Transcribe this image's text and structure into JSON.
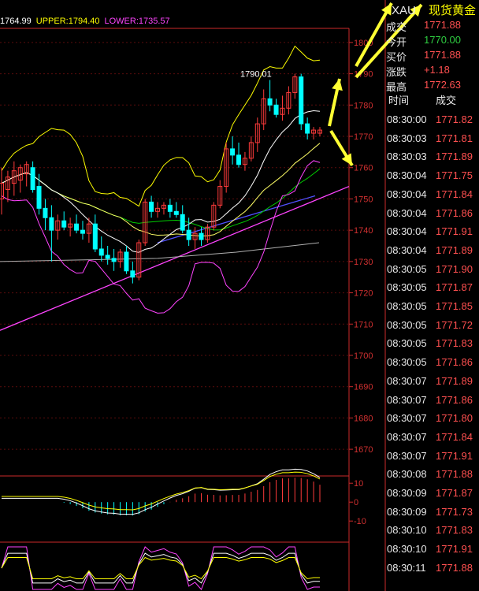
{
  "header": {
    "mid_label": "1764.99",
    "upper_label": "UPPER:1794.40",
    "lower_label": "LOWER:1735.57"
  },
  "chart_data": {
    "type": "candlestick",
    "y_ticks": [
      "1800",
      "1790",
      "1780",
      "1770",
      "1760",
      "1750",
      "1740",
      "1730",
      "1720",
      "1710",
      "1700",
      "1690",
      "1680",
      "1670"
    ],
    "ylim": [
      1666,
      1804
    ],
    "peak_label": "1790.01",
    "candles": [
      {
        "o": 1750,
        "h": 1760,
        "l": 1745,
        "c": 1755
      },
      {
        "o": 1753,
        "h": 1759,
        "l": 1749,
        "c": 1757
      },
      {
        "o": 1755,
        "h": 1762,
        "l": 1751,
        "c": 1759
      },
      {
        "o": 1756,
        "h": 1761,
        "l": 1752,
        "c": 1760
      },
      {
        "o": 1758,
        "h": 1762,
        "l": 1754,
        "c": 1761
      },
      {
        "o": 1760,
        "h": 1762,
        "l": 1752,
        "c": 1753
      },
      {
        "o": 1754,
        "h": 1758,
        "l": 1745,
        "c": 1747
      },
      {
        "o": 1747,
        "h": 1750,
        "l": 1740,
        "c": 1744
      },
      {
        "o": 1744,
        "h": 1748,
        "l": 1730,
        "c": 1740
      },
      {
        "o": 1740,
        "h": 1745,
        "l": 1737,
        "c": 1743
      },
      {
        "o": 1743,
        "h": 1746,
        "l": 1740,
        "c": 1741
      },
      {
        "o": 1741,
        "h": 1744,
        "l": 1738,
        "c": 1742
      },
      {
        "o": 1742,
        "h": 1745,
        "l": 1739,
        "c": 1740
      },
      {
        "o": 1740,
        "h": 1743,
        "l": 1737,
        "c": 1739
      },
      {
        "o": 1739,
        "h": 1744,
        "l": 1736,
        "c": 1742
      },
      {
        "o": 1742,
        "h": 1745,
        "l": 1733,
        "c": 1734
      },
      {
        "o": 1734,
        "h": 1738,
        "l": 1730,
        "c": 1732
      },
      {
        "o": 1732,
        "h": 1735,
        "l": 1729,
        "c": 1731
      },
      {
        "o": 1731,
        "h": 1734,
        "l": 1727,
        "c": 1730
      },
      {
        "o": 1730,
        "h": 1734,
        "l": 1728,
        "c": 1733
      },
      {
        "o": 1733,
        "h": 1735,
        "l": 1726,
        "c": 1727
      },
      {
        "o": 1727,
        "h": 1730,
        "l": 1723,
        "c": 1725
      },
      {
        "o": 1725,
        "h": 1737,
        "l": 1724,
        "c": 1736
      },
      {
        "o": 1736,
        "h": 1750,
        "l": 1735,
        "c": 1749
      },
      {
        "o": 1749,
        "h": 1751,
        "l": 1744,
        "c": 1746
      },
      {
        "o": 1746,
        "h": 1749,
        "l": 1744,
        "c": 1747
      },
      {
        "o": 1747,
        "h": 1749,
        "l": 1745,
        "c": 1748
      },
      {
        "o": 1748,
        "h": 1750,
        "l": 1744,
        "c": 1746
      },
      {
        "o": 1746,
        "h": 1749,
        "l": 1744,
        "c": 1745
      },
      {
        "o": 1745,
        "h": 1748,
        "l": 1739,
        "c": 1740
      },
      {
        "o": 1740,
        "h": 1744,
        "l": 1735,
        "c": 1737
      },
      {
        "o": 1737,
        "h": 1741,
        "l": 1734,
        "c": 1739
      },
      {
        "o": 1739,
        "h": 1741,
        "l": 1735,
        "c": 1737
      },
      {
        "o": 1737,
        "h": 1742,
        "l": 1736,
        "c": 1741
      },
      {
        "o": 1741,
        "h": 1749,
        "l": 1740,
        "c": 1748
      },
      {
        "o": 1748,
        "h": 1756,
        "l": 1747,
        "c": 1754
      },
      {
        "o": 1754,
        "h": 1768,
        "l": 1752,
        "c": 1766
      },
      {
        "o": 1766,
        "h": 1770,
        "l": 1761,
        "c": 1764
      },
      {
        "o": 1764,
        "h": 1768,
        "l": 1760,
        "c": 1761
      },
      {
        "o": 1761,
        "h": 1765,
        "l": 1759,
        "c": 1763
      },
      {
        "o": 1763,
        "h": 1770,
        "l": 1762,
        "c": 1768
      },
      {
        "o": 1768,
        "h": 1776,
        "l": 1765,
        "c": 1774
      },
      {
        "o": 1774,
        "h": 1785,
        "l": 1772,
        "c": 1782
      },
      {
        "o": 1782,
        "h": 1788,
        "l": 1778,
        "c": 1780
      },
      {
        "o": 1780,
        "h": 1782,
        "l": 1776,
        "c": 1777
      },
      {
        "o": 1777,
        "h": 1783,
        "l": 1775,
        "c": 1779
      },
      {
        "o": 1779,
        "h": 1786,
        "l": 1777,
        "c": 1784
      },
      {
        "o": 1784,
        "h": 1790,
        "l": 1782,
        "c": 1789
      },
      {
        "o": 1789,
        "h": 1790,
        "l": 1772,
        "c": 1774
      },
      {
        "o": 1774,
        "h": 1776,
        "l": 1769,
        "c": 1771
      },
      {
        "o": 1771,
        "h": 1773,
        "l": 1769,
        "c": 1772
      },
      {
        "o": 1771,
        "h": 1773,
        "l": 1770,
        "c": 1772
      }
    ],
    "macd_ticks": [
      "10",
      "0",
      "-10"
    ],
    "macd_ylim": [
      -12,
      13
    ]
  },
  "quote": {
    "symbol": "XAU",
    "name": "现货黄金",
    "rows": [
      {
        "label": "成交",
        "value": "1771.88",
        "color": "#ff5050"
      },
      {
        "label": "今开",
        "value": "1770.00",
        "color": "#2ecc40"
      },
      {
        "label": "买价",
        "value": "1771.88",
        "color": "#ff5050"
      },
      {
        "label": "涨跌",
        "value": "+1.18",
        "color": "#ff5050"
      },
      {
        "label": "最高",
        "value": "1772.63",
        "color": "#ff5050"
      }
    ],
    "table_headers": [
      "时间",
      "成交"
    ],
    "ticks": [
      {
        "time": "08:30:00",
        "price": "1771.82"
      },
      {
        "time": "08:30:03",
        "price": "1771.81"
      },
      {
        "time": "08:30:03",
        "price": "1771.89"
      },
      {
        "time": "08:30:04",
        "price": "1771.75"
      },
      {
        "time": "08:30:04",
        "price": "1771.84"
      },
      {
        "time": "08:30:04",
        "price": "1771.86"
      },
      {
        "time": "08:30:04",
        "price": "1771.91"
      },
      {
        "time": "08:30:04",
        "price": "1771.89"
      },
      {
        "time": "08:30:05",
        "price": "1771.90"
      },
      {
        "time": "08:30:05",
        "price": "1771.87"
      },
      {
        "time": "08:30:05",
        "price": "1771.85"
      },
      {
        "time": "08:30:05",
        "price": "1771.72"
      },
      {
        "time": "08:30:05",
        "price": "1771.83"
      },
      {
        "time": "08:30:05",
        "price": "1771.86"
      },
      {
        "time": "08:30:07",
        "price": "1771.89"
      },
      {
        "time": "08:30:07",
        "price": "1771.86"
      },
      {
        "time": "08:30:07",
        "price": "1771.80"
      },
      {
        "time": "08:30:07",
        "price": "1771.84"
      },
      {
        "time": "08:30:07",
        "price": "1771.91"
      },
      {
        "time": "08:30:08",
        "price": "1771.88"
      },
      {
        "time": "08:30:09",
        "price": "1771.87"
      },
      {
        "time": "08:30:09",
        "price": "1771.73"
      },
      {
        "time": "08:30:10",
        "price": "1771.83"
      },
      {
        "time": "08:30:10",
        "price": "1771.91"
      },
      {
        "time": "08:30:11",
        "price": "1771.88"
      }
    ]
  },
  "colors": {
    "up": "#ff3b3b",
    "down": "#00ffff",
    "axis": "#cc2a2a",
    "mid": "#ffffff",
    "upper": "#ffff00",
    "lower": "#ff44ff",
    "arrow": "#ffff33"
  }
}
